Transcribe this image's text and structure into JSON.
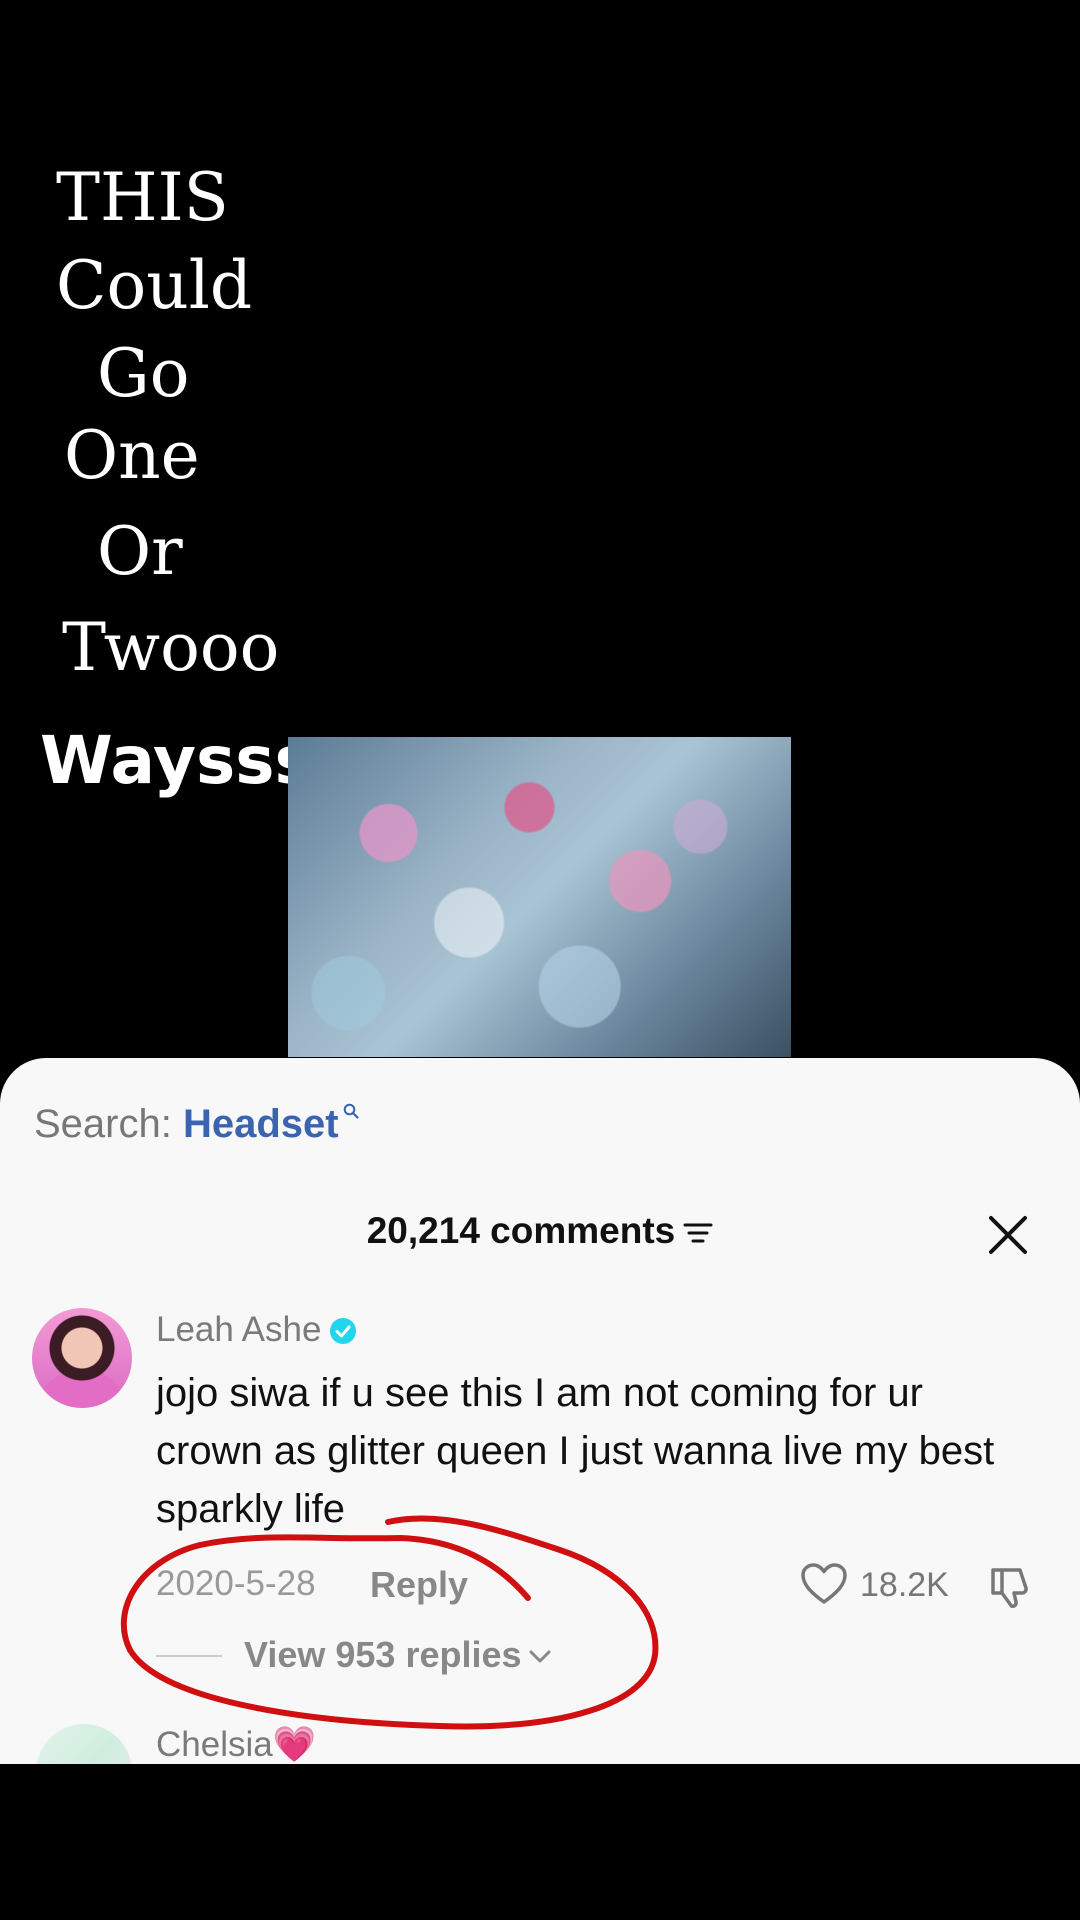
{
  "video_overlay": {
    "lines": [
      "THIS",
      "Could",
      "Go",
      "One",
      "Or",
      "Twooo"
    ],
    "bold_word": "Waysss"
  },
  "comments_panel": {
    "search_label": "Search:",
    "search_term": "Headset",
    "header": "20,214 comments",
    "comment": {
      "username": "Leah Ashe",
      "text": "jojo siwa if u see this I am not coming for ur crown as glitter queen I just wanna live my best sparkly life",
      "date": "2020-5-28",
      "reply_label": "Reply",
      "likes": "18.2K",
      "view_replies": "View 953 replies"
    },
    "next_comment": {
      "username": "Chelsia💗"
    }
  },
  "colors": {
    "accent_link": "#3a63b0",
    "verified": "#20d5ec",
    "annotation": "#d01010"
  }
}
